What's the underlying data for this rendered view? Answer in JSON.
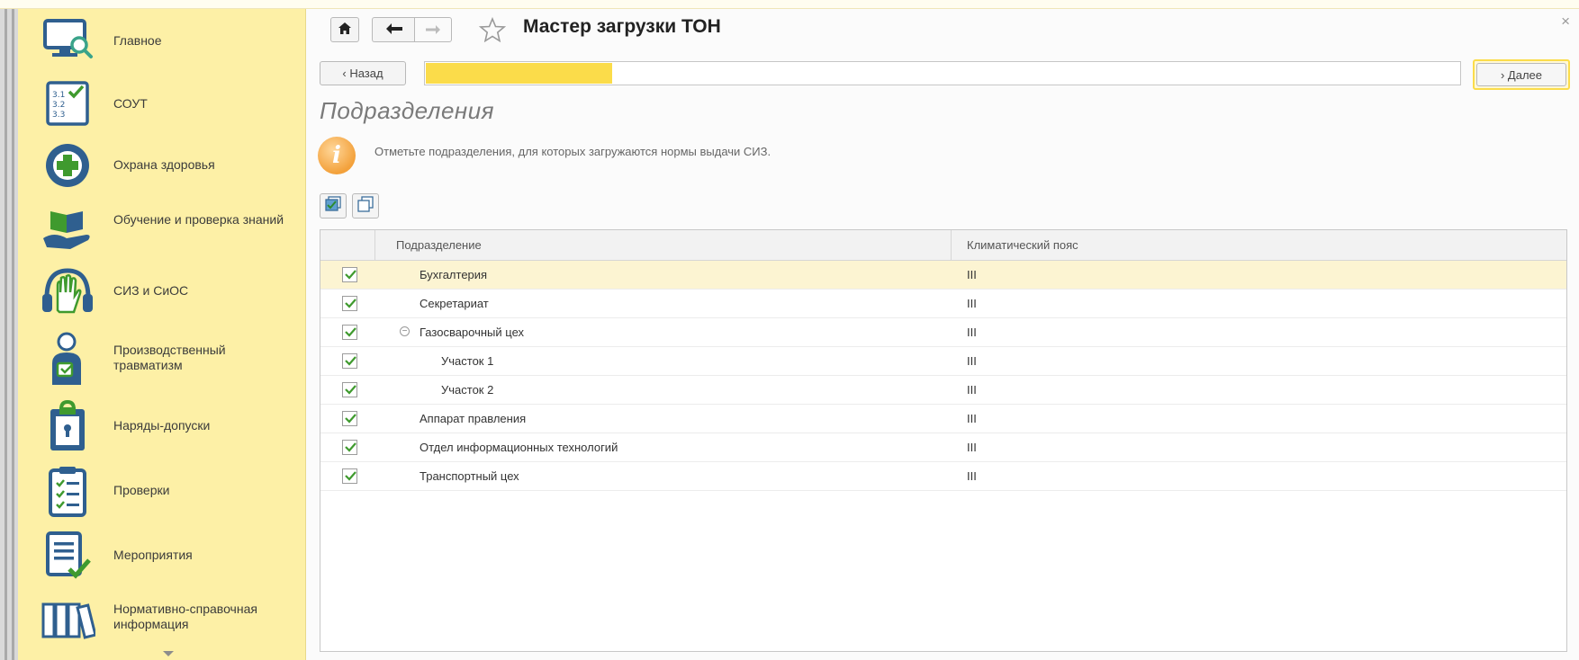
{
  "sidebar": {
    "items": [
      {
        "label": "Главное",
        "icon": "monitor-search-icon"
      },
      {
        "label": "СОУТ",
        "icon": "checklist-icon"
      },
      {
        "label": "Охрана здоровья",
        "icon": "medical-cross-icon"
      },
      {
        "label": "Обучение и проверка знаний",
        "icon": "book-hand-icon"
      },
      {
        "label": "СИЗ и СиОС",
        "icon": "glove-headphones-icon"
      },
      {
        "label": "Производственный травматизм",
        "icon": "injured-person-icon"
      },
      {
        "label": "Наряды-допуски",
        "icon": "lock-clipboard-icon"
      },
      {
        "label": "Проверки",
        "icon": "check-clipboard-icon"
      },
      {
        "label": "Мероприятия",
        "icon": "document-check-icon"
      },
      {
        "label": "Нормативно-справочная информация",
        "icon": "books-icon"
      }
    ]
  },
  "header": {
    "title": "Мастер загрузки ТОН",
    "back_label": "‹ Назад",
    "next_label": "› Далее",
    "progress": 0.18
  },
  "page": {
    "heading": "Подразделения",
    "info_text": "Отметьте подразделения, для которых загружаются нормы выдачи СИЗ."
  },
  "table": {
    "columns": [
      "Подразделение",
      "Климатический пояс"
    ],
    "rows": [
      {
        "name": "Бухгалтерия",
        "zone": "III",
        "checked": true,
        "level": 0,
        "group": false,
        "selected": true
      },
      {
        "name": "Секретариат",
        "zone": "III",
        "checked": true,
        "level": 0,
        "group": false,
        "selected": false
      },
      {
        "name": "Газосварочный цех",
        "zone": "III",
        "checked": true,
        "level": 0,
        "group": true,
        "selected": false
      },
      {
        "name": "Участок 1",
        "zone": "III",
        "checked": true,
        "level": 1,
        "group": false,
        "selected": false
      },
      {
        "name": "Участок 2",
        "zone": "III",
        "checked": true,
        "level": 1,
        "group": false,
        "selected": false
      },
      {
        "name": "Аппарат правления",
        "zone": "III",
        "checked": true,
        "level": 0,
        "group": false,
        "selected": false
      },
      {
        "name": "Отдел информационных технологий",
        "zone": "III",
        "checked": true,
        "level": 0,
        "group": false,
        "selected": false
      },
      {
        "name": "Транспортный цех",
        "zone": "III",
        "checked": true,
        "level": 0,
        "group": false,
        "selected": false
      }
    ]
  },
  "colors": {
    "sidebar_bg": "#fdf0a6",
    "accent": "#fbdc4a",
    "check": "#3f9a2e",
    "icon_blue": "#2f5f8f",
    "selected_row": "#fcf4d2"
  }
}
